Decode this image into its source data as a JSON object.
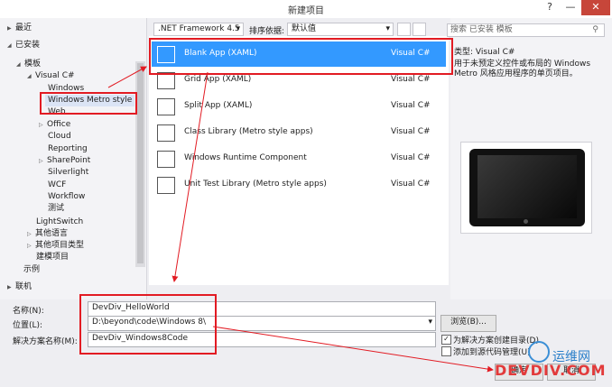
{
  "window": {
    "title": "新建项目",
    "buttons": [
      "?",
      "—",
      "✕"
    ]
  },
  "sidebar": {
    "recent": "最近",
    "installed": "已安装",
    "templates": "模板",
    "visual_csharp": "Visual C#",
    "items": [
      "Windows",
      "Windows Metro style",
      "Web",
      "Office",
      "Cloud",
      "Reporting",
      "SharePoint",
      "Silverlight",
      "WCF",
      "Workflow",
      "测试"
    ],
    "lightswitch": "LightSwitch",
    "other_languages": "其他语言",
    "other_project_types": "其他项目类型",
    "modeling": "建模项目",
    "samples": "示例",
    "online": "联机"
  },
  "toolbar": {
    "framework": ".NET Framework 4.5",
    "sort_label": "排序依据:",
    "sort_value": "默认值",
    "search_placeholder": "搜索 已安装 模板"
  },
  "templates": [
    {
      "name": "Blank App (XAML)",
      "lang": "Visual C#"
    },
    {
      "name": "Grid App (XAML)",
      "lang": "Visual C#"
    },
    {
      "name": "Split App (XAML)",
      "lang": "Visual C#"
    },
    {
      "name": "Class Library (Metro style apps)",
      "lang": "Visual C#"
    },
    {
      "name": "Windows Runtime Component",
      "lang": "Visual C#"
    },
    {
      "name": "Unit Test Library (Metro style apps)",
      "lang": "Visual C#"
    }
  ],
  "details": {
    "type_label": "类型:",
    "type_value": "Visual C#",
    "description": "用于未预定义控件或布局的 Windows Metro 风格应用程序的单页项目。"
  },
  "form": {
    "name_label": "名称(N):",
    "name_value": "DevDiv_HelloWorld",
    "location_label": "位置(L):",
    "location_value": "D:\\beyond\\code\\Windows 8\\",
    "solution_label": "解决方案名称(M):",
    "solution_value": "DevDiv_Windows8Code",
    "browse": "浏览(B)...",
    "create_dir": "为解决方案创建目录(D)",
    "add_to_source": "添加到源代码管理(U)",
    "ok": "确定",
    "cancel": "取消"
  },
  "watermark": {
    "cn": "运维网",
    "en": "DEVDIV.COM"
  }
}
